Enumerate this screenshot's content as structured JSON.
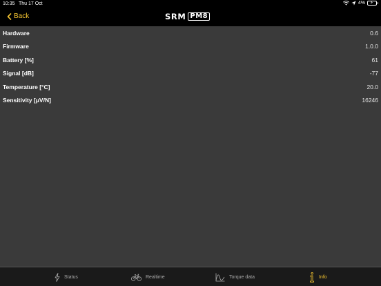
{
  "status_bar": {
    "time": "10:35",
    "date": "Thu 17 Oct",
    "battery": "4%"
  },
  "nav": {
    "back_label": "Back",
    "logo_text": "SRM",
    "logo_box": "PM8"
  },
  "rows": [
    {
      "label": "Hardware",
      "value": "0.6"
    },
    {
      "label": "Firmware",
      "value": "1.0.0"
    },
    {
      "label": "Battery [%]",
      "value": "61"
    },
    {
      "label": "Signal [dB]",
      "value": "-77"
    },
    {
      "label": "Temperature [°C]",
      "value": "20.0"
    },
    {
      "label": "Sensitivity [μV/N]",
      "value": "16246"
    }
  ],
  "tabs": [
    {
      "label": "Status",
      "icon": "lightning-icon"
    },
    {
      "label": "Realtime",
      "icon": "bicycle-icon"
    },
    {
      "label": "Torque data",
      "icon": "torque-graph-icon"
    },
    {
      "label": "Info",
      "icon": "info-icon"
    }
  ],
  "colors": {
    "accent": "#f2c230",
    "background": "#3a3a3a",
    "bar": "#000000",
    "tab_bar": "#1a1a1a"
  }
}
